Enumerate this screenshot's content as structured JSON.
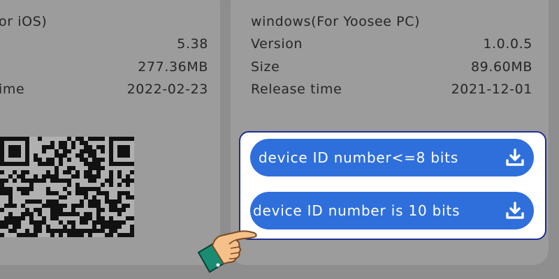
{
  "ios": {
    "title": "or iOS)",
    "rows": [
      {
        "label": "",
        "value": "5.38"
      },
      {
        "label": "",
        "value": "277.36MB"
      },
      {
        "label": "ime",
        "value": "2022-02-23"
      }
    ]
  },
  "windows": {
    "title": "windows(For Yoosee PC)",
    "rows": [
      {
        "label": "Version",
        "value": "1.0.0.5"
      },
      {
        "label": "Size",
        "value": "89.60MB"
      },
      {
        "label": "Release time",
        "value": "2021-12-01"
      }
    ]
  },
  "downloads": {
    "button1_label": "device ID number<=8 bits",
    "button2_label": "device ID number is 10 bits",
    "icon": "download-icon"
  },
  "colors": {
    "background": "#8e8e8e",
    "card": "#9c9c9c",
    "button": "#2f6fdc",
    "panel_border": "#1f2f8f"
  },
  "icons": {
    "qr": "qr-code-icon",
    "hand": "pointing-hand-icon"
  }
}
